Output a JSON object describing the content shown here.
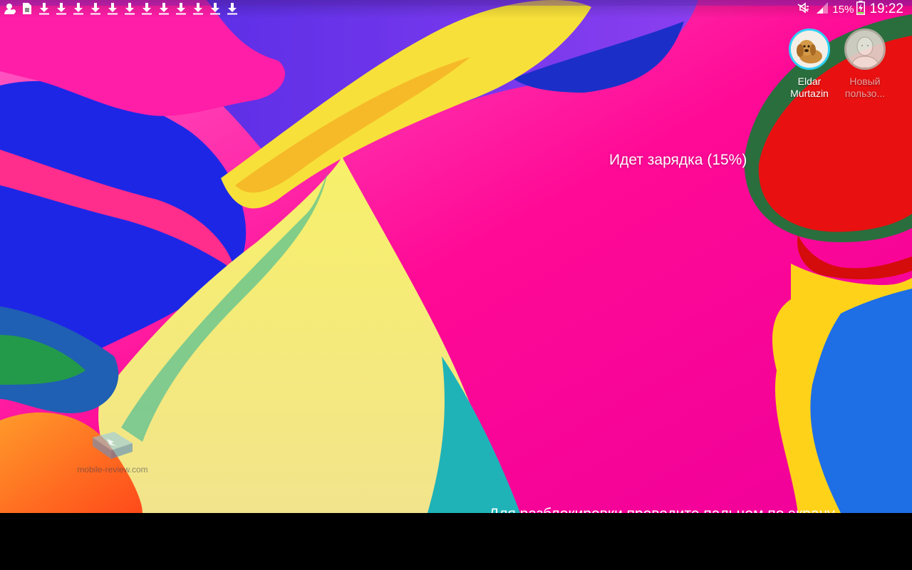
{
  "status_bar": {
    "notifications": [
      {
        "icon": "person-icon"
      },
      {
        "icon": "sim-card-icon"
      },
      {
        "icon": "download-icon"
      },
      {
        "icon": "download-icon"
      },
      {
        "icon": "download-icon"
      },
      {
        "icon": "download-icon"
      },
      {
        "icon": "download-icon"
      },
      {
        "icon": "download-icon"
      },
      {
        "icon": "download-icon"
      },
      {
        "icon": "download-icon"
      },
      {
        "icon": "download-icon"
      },
      {
        "icon": "download-icon"
      },
      {
        "icon": "download-icon"
      },
      {
        "icon": "download-icon"
      }
    ],
    "system_icons": [
      "mute-icon",
      "signal-icon",
      "battery-charging-icon"
    ],
    "battery": "15%",
    "time": "19:22"
  },
  "users": [
    {
      "name": "Eldar\nMurtazin",
      "active": true,
      "avatar": "dog-avatar-icon"
    },
    {
      "name": "Новый\nпользо...",
      "active": false,
      "avatar": "default-user-icon"
    }
  ],
  "lockscreen": {
    "charging_text": "Идет зарядка (15%)",
    "unlock_hint": "Для разблокировки проведите пальцем по экрану"
  },
  "watermark": {
    "text": "mobile-review.com"
  },
  "colors": {
    "active_user_ring": "#2fd0f5",
    "background": "#000000"
  }
}
